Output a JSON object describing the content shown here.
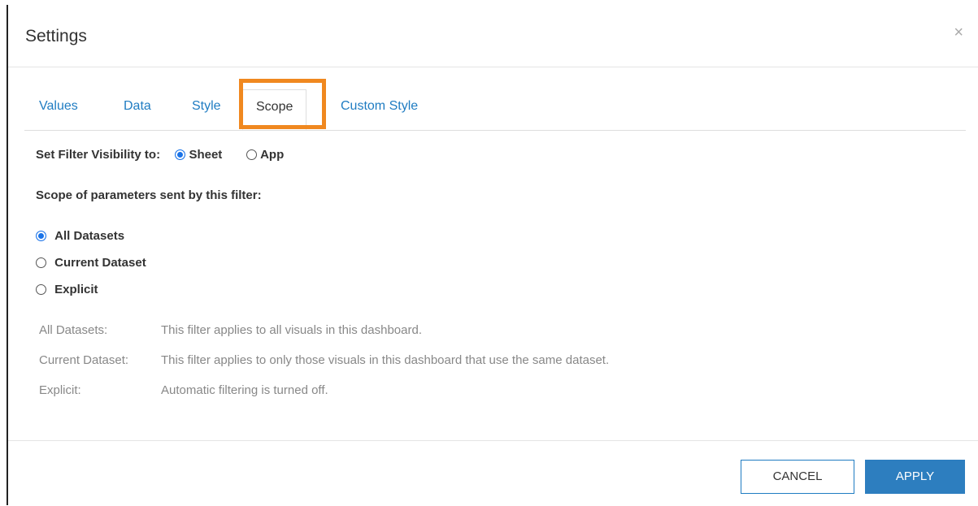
{
  "dialog": {
    "title": "Settings",
    "close_glyph": "×"
  },
  "tabs": [
    {
      "label": "Values"
    },
    {
      "label": "Data"
    },
    {
      "label": "Style"
    },
    {
      "label": "Scope"
    },
    {
      "label": "Custom Style"
    }
  ],
  "active_tab": "Scope",
  "visibility": {
    "label": "Set Filter Visibility to:",
    "options": [
      {
        "label": "Sheet",
        "checked": true
      },
      {
        "label": "App",
        "checked": false
      }
    ]
  },
  "scope": {
    "heading": "Scope of parameters sent by this filter:",
    "options": [
      {
        "label": "All Datasets",
        "checked": true
      },
      {
        "label": "Current Dataset",
        "checked": false
      },
      {
        "label": "Explicit",
        "checked": false
      }
    ],
    "descriptions": [
      {
        "term": "All Datasets:",
        "text": "This filter applies to all visuals in this dashboard."
      },
      {
        "term": "Current Dataset:",
        "text": "This filter applies to only those visuals in this dashboard that use the same dataset."
      },
      {
        "term": "Explicit:",
        "text": "Automatic filtering is turned off."
      }
    ]
  },
  "footer": {
    "cancel_label": "CANCEL",
    "apply_label": "APPLY"
  },
  "colors": {
    "accent": "#1f7cc2",
    "highlight": "#f0881f",
    "apply": "#2d7ebf"
  }
}
